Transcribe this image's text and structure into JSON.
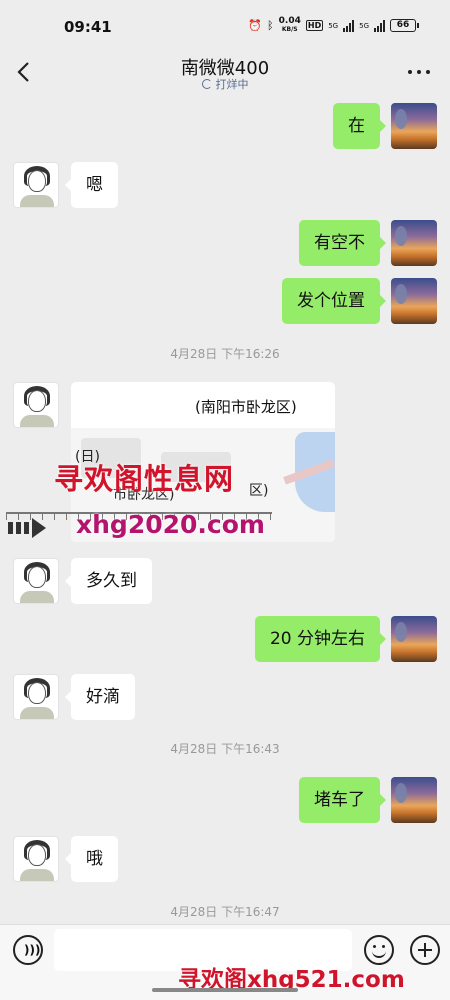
{
  "status_bar": {
    "time": "09:41",
    "net_speed_value": "0.04",
    "net_speed_unit": "KB/S",
    "hd": "HD",
    "signal_1": "5G",
    "signal_2": "5G",
    "battery": "66"
  },
  "header": {
    "title": "南微微400",
    "subtitle": "打烊中"
  },
  "messages": {
    "m1": "在",
    "m2": "嗯",
    "m3": "有空不",
    "m4": "发个位置",
    "ts1": "4月28日 下午16:26",
    "location": {
      "address": "(南阳市卧龙区)",
      "map_text_1": "(日)",
      "map_text_2": "市卧龙区)",
      "map_text_3": "区)"
    },
    "m5": "多久到",
    "m6": "20 分钟左右",
    "m7": "好滴",
    "ts2": "4月28日 下午16:43",
    "m8": "堵车了",
    "m9": "哦",
    "ts3": "4月28日 下午16:47"
  },
  "watermarks": {
    "w1": "寻欢阁性息网",
    "w2": "xhg2020.com",
    "w3": "寻欢阁xhg521.com"
  },
  "input": {
    "value": "",
    "placeholder": ""
  },
  "icons": {
    "back": "back-chevron-icon",
    "more": "more-dots-icon",
    "voice": "voice-icon",
    "emoji": "emoji-icon",
    "plus": "plus-icon"
  },
  "colors": {
    "background": "#ededed",
    "my_bubble": "#95ec69",
    "their_bubble": "#ffffff",
    "subtitle": "#576b95"
  }
}
